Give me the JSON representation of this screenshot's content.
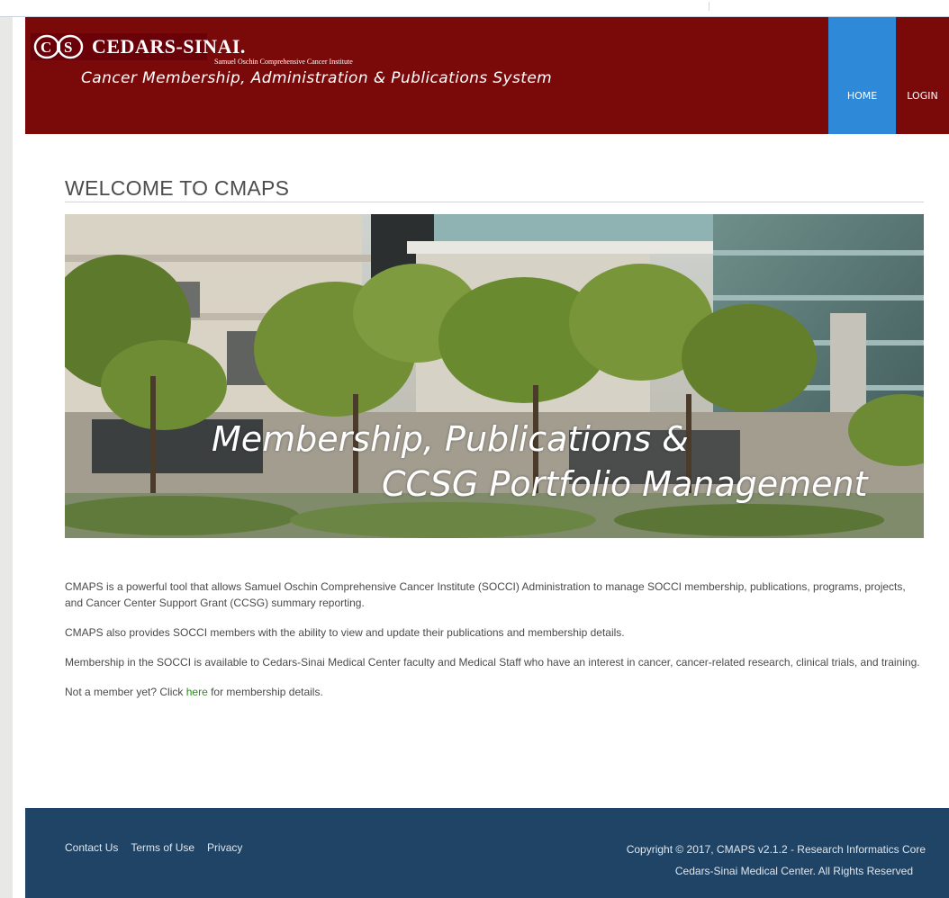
{
  "header": {
    "logo_text": "CEDARS-SINAI.",
    "institute": "Samuel Oschin Comprehensive Cancer Institute",
    "system_title": "Cancer Membership, Administration & Publications System",
    "nav": [
      {
        "label": "HOME"
      },
      {
        "label": "LOGIN"
      }
    ]
  },
  "main": {
    "welcome_title": "WELCOME TO CMAPS",
    "hero": {
      "line1": "Membership, Publications &",
      "line2": "CCSG Portfolio Management"
    },
    "paragraphs": [
      "CMAPS is a powerful tool that allows Samuel Oschin Comprehensive Cancer Institute (SOCCI) Administration to manage SOCCI membership, publications, programs, projects, and Cancer Center Support Grant (CCSG) summary reporting.",
      "CMAPS also provides SOCCI members with the ability to view and update their publications and membership details.",
      "Membership in the SOCCI is available to Cedars-Sinai Medical Center faculty and Medical Staff who have an interest in cancer, cancer-related research, clinical trials, and training."
    ],
    "not_member": {
      "before": "Not a member yet? Click ",
      "link": "here",
      "after": " for membership details."
    }
  },
  "footer": {
    "links": [
      "Contact Us",
      "Terms of Use",
      "Privacy"
    ],
    "copyright_line1": "Copyright © 2017, CMAPS v2.1.2 - Research Informatics Core",
    "copyright_line2": "Cedars-Sinai Medical Center. All Rights Reserved"
  },
  "colors": {
    "header_bg": "#7a0a0a",
    "nav_active": "#2e8ad8",
    "footer_bg": "#1f4466",
    "link": "#2e8b1f"
  }
}
